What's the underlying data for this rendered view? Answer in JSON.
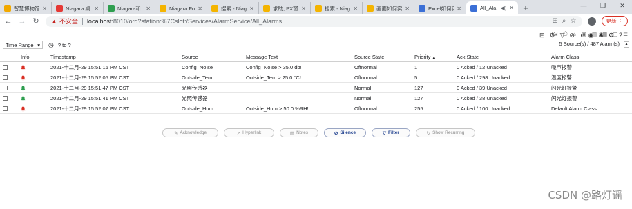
{
  "browser": {
    "tabs": [
      {
        "title": "智慧博物馆",
        "color": "#f2a900"
      },
      {
        "title": "Niagara 桌",
        "color": "#e53935"
      },
      {
        "title": "Niagara和",
        "color": "#2e9e4f"
      },
      {
        "title": "Niagara Fo",
        "color": "#f4b400"
      },
      {
        "title": "搜索 - Niag",
        "color": "#f4b400"
      },
      {
        "title": "求助, PX窗",
        "color": "#f4b400"
      },
      {
        "title": "搜索 - Niag",
        "color": "#f4b400"
      },
      {
        "title": "画面如何实",
        "color": "#f4b400"
      },
      {
        "title": "Excel如何实",
        "color": "#3b6fd6"
      },
      {
        "title": "All_Ala",
        "color": "#3b6fd6",
        "active": true
      }
    ],
    "insecure_label": "不安全",
    "url_host": "localhost",
    "url_path": ":8010/ord?station:%7Cslot:/Services/AlarmService/All_Alarms",
    "update_label": "更新"
  },
  "filter": {
    "time_range_label": "Time Range",
    "range_text": "? to ?",
    "summary": "5 Source(s) / 487 Alarm(s)"
  },
  "table": {
    "headers": [
      "",
      "Info",
      "Timestamp",
      "Source",
      "Message Text",
      "Source State",
      "Priority",
      "Ack State",
      "Alarm Class"
    ],
    "rows": [
      {
        "bell": "#d93025",
        "timestamp": "2021-十二月-29 15:51:16 PM CST",
        "source": "Config_Noise",
        "message": "Config_Noise > 35.0 db!",
        "state": "Offnormal",
        "priority": "1",
        "ack": "0 Acked / 12 Unacked",
        "class": "噪声报警"
      },
      {
        "bell": "#d93025",
        "timestamp": "2021-十二月-29 15:52:05 PM CST",
        "source": "Outside_Tem",
        "message": "Outside_Tem > 25.0 °C!",
        "state": "Offnormal",
        "priority": "5",
        "ack": "0 Acked / 298 Unacked",
        "class": "温度报警"
      },
      {
        "bell": "#2e9e4f",
        "timestamp": "2021-十二月-29 15:51:47 PM CST",
        "source": "光照传感器",
        "message": "",
        "state": "Normal",
        "priority": "127",
        "ack": "0 Acked / 39 Unacked",
        "class": "闪光灯报警"
      },
      {
        "bell": "#2e9e4f",
        "timestamp": "2021-十二月-29 15:51:41 PM CST",
        "source": "光照传感器",
        "message": "",
        "state": "Normal",
        "priority": "127",
        "ack": "0 Acked / 38 Unacked",
        "class": "闪光灯报警"
      },
      {
        "bell": "#d93025",
        "timestamp": "2021-十二月-29 15:52:07 PM CST",
        "source": "Outside_Hum",
        "message": "Outside_Hum > 50.0 %RH!",
        "state": "Offnormal",
        "priority": "255",
        "ack": "0 Acked / 100 Unacked",
        "class": "Default Alarm Class"
      }
    ]
  },
  "actions": {
    "acknowledge": "Acknowledge",
    "hyperlink": "Hyperlink",
    "notes": "Notes",
    "silence": "Silence",
    "filter": "Filter",
    "show_recurring": "Show Recurring"
  },
  "watermark": "CSDN @路灯谣"
}
